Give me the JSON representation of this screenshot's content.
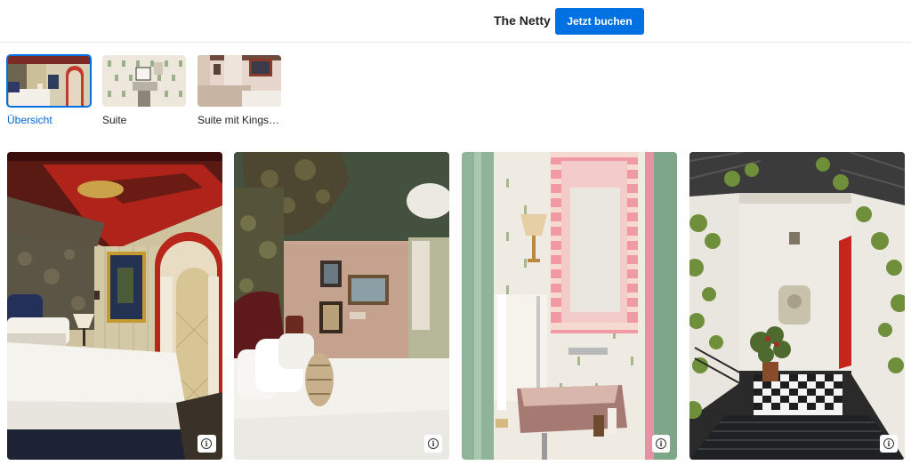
{
  "header": {
    "hotel_name": "The Netty",
    "book_label": "Jetzt buchen"
  },
  "tabs": [
    {
      "label": "Übersicht",
      "active": true
    },
    {
      "label": "Suite",
      "active": false
    },
    {
      "label": "Suite mit Kings…",
      "active": false
    }
  ],
  "gallery": {
    "photos": [
      {
        "alt": "bedroom-red-ceiling",
        "info_icon": "info-icon"
      },
      {
        "alt": "bedroom-green-ceiling",
        "info_icon": "info-icon"
      },
      {
        "alt": "pink-bathroom-sink",
        "info_icon": "info-icon"
      },
      {
        "alt": "entrance-stairway-ivy",
        "info_icon": "info-icon"
      }
    ]
  },
  "colors": {
    "accent": "#0071e3",
    "active_tab_text": "#0066cc"
  }
}
